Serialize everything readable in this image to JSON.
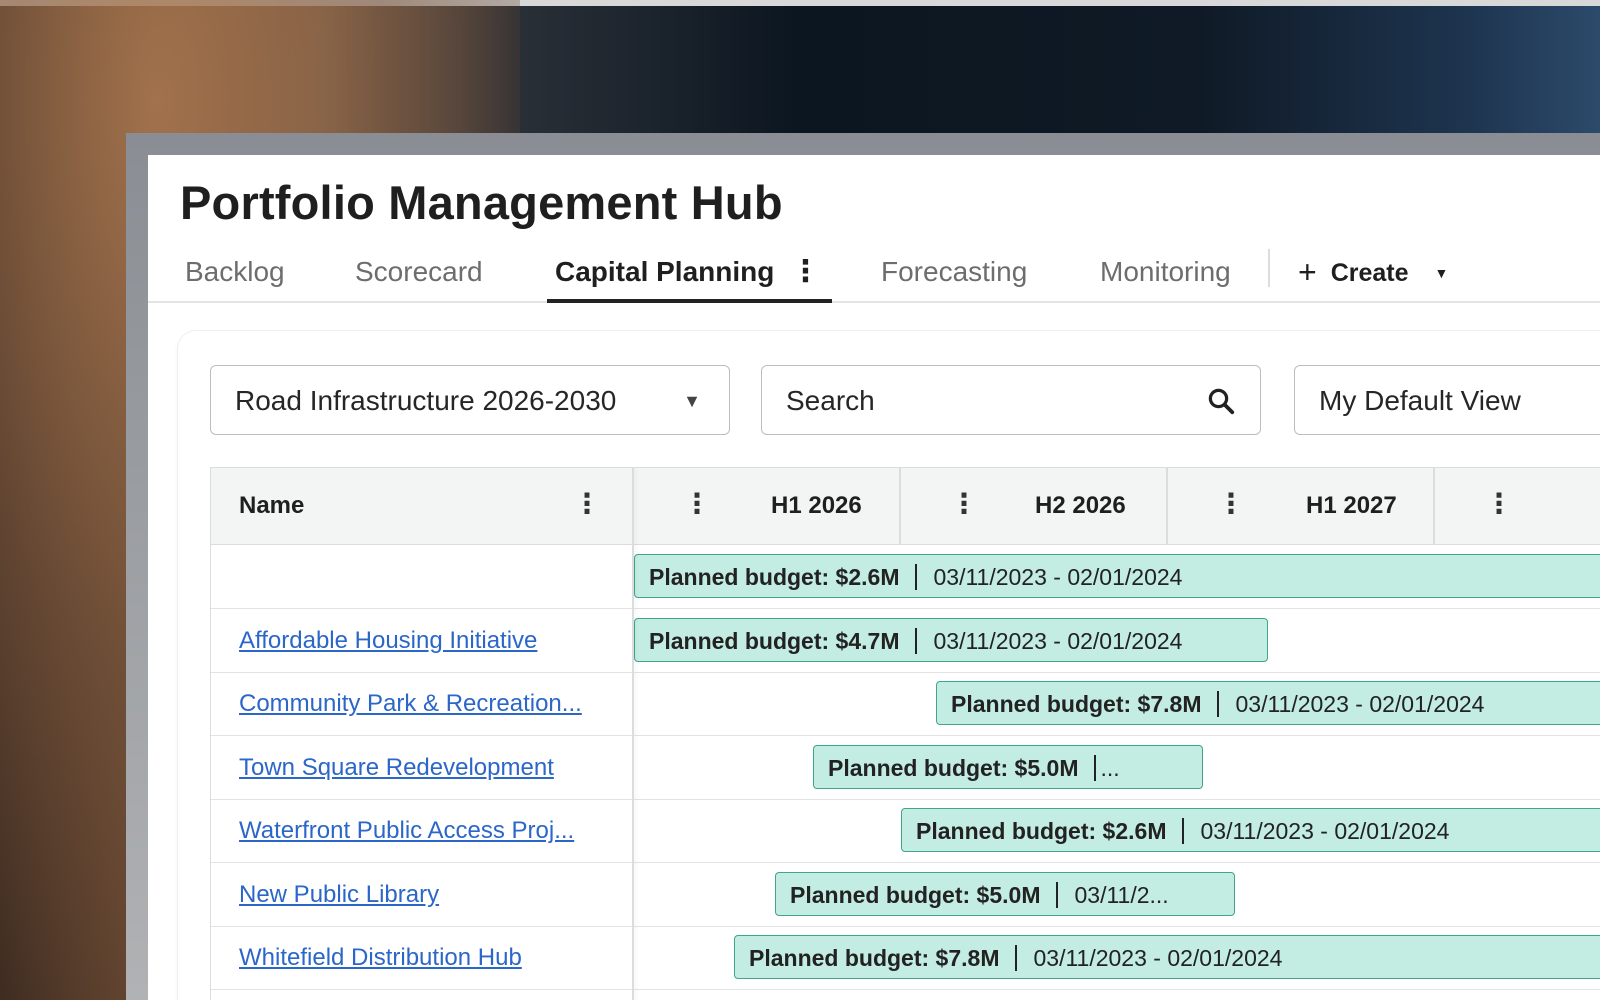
{
  "app": {
    "title": "Portfolio Management Hub"
  },
  "tabs": [
    {
      "label": "Backlog",
      "active": false
    },
    {
      "label": "Scorecard",
      "active": false
    },
    {
      "label": "Capital Planning",
      "active": true
    },
    {
      "label": "Forecasting",
      "active": false
    },
    {
      "label": "Monitoring",
      "active": false
    }
  ],
  "create": {
    "label": "Create"
  },
  "toolbar": {
    "portfolio_select": "Road Infrastructure 2026-2030",
    "search_placeholder": "Search",
    "view_select": "My Default View"
  },
  "grid": {
    "name_header": "Name",
    "period_headers": [
      "H1 2026",
      "H2 2026",
      "H1 2027"
    ],
    "rows": [
      {
        "name": "",
        "budget": "Planned budget: $2.6M",
        "dates": "03/11/2023 - 02/01/2024"
      },
      {
        "name": "Affordable Housing Initiative",
        "budget": "Planned budget: $4.7M",
        "dates": "03/11/2023 - 02/01/2024"
      },
      {
        "name": "Community Park & Recreation...",
        "budget": "Planned budget: $7.8M",
        "dates": "03/11/2023 - 02/01/2024"
      },
      {
        "name": "Town Square Redevelopment",
        "budget": "Planned budget: $5.0M",
        "dates": "..."
      },
      {
        "name": "Waterfront Public Access Proj...",
        "budget": "Planned budget: $2.6M",
        "dates": "03/11/2023 - 02/01/2024"
      },
      {
        "name": "New Public Library",
        "budget": "Planned budget: $5.0M",
        "dates": "03/11/2..."
      },
      {
        "name": "Whitefield Distribution Hub",
        "budget": "Planned budget: $7.8M",
        "dates": "03/11/2023 - 02/01/2024"
      }
    ]
  },
  "colors": {
    "bar_fill": "#c3ece2",
    "bar_border": "#3fa58e",
    "link": "#2b66c9"
  },
  "icons": {
    "search": "search-icon",
    "kebab": "kebab-icon",
    "caret": "chevron-down-icon",
    "plus": "plus-icon"
  }
}
